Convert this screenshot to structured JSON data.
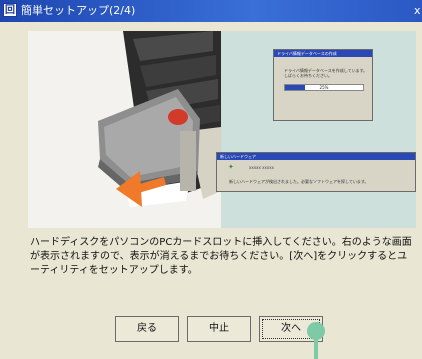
{
  "window": {
    "title": "簡単セットアップ(2/4)",
    "icon_glyph": "回",
    "close_glyph": "x"
  },
  "illustration": {
    "dialog_progress": {
      "title": "ドライバ情報データベースの作成",
      "message": "ドライバ情報データベースを作成しています。しばらくお待ちください。",
      "progress_percent": 25,
      "progress_label": "25%"
    },
    "dialog_new_hardware": {
      "title": "新しいハードウェア",
      "value": "xxxxx xxxxx",
      "message": "新しいハードウェアが検出されました。必要なソフトウェアを探しています。"
    }
  },
  "instruction": "ハードディスクをパソコンのPCカードスロットに挿入してください。右のような画面が表示されますので、表示が消えるまでお待ちください。[次へ]をクリックするとユーティリティをセットアップします。",
  "buttons": {
    "back": "戻る",
    "cancel": "中止",
    "next": "次へ"
  },
  "colors": {
    "titlebar": "#1d46b0",
    "window_bg": "#e9e6d4",
    "arrow": "#f07a2a",
    "pointer": "#7ec9a6"
  }
}
